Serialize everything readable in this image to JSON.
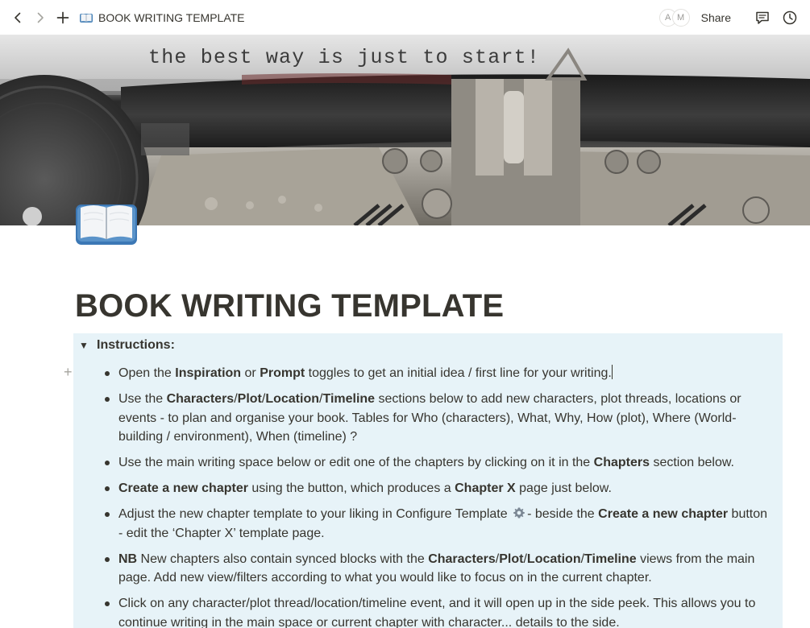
{
  "topbar": {
    "breadcrumb_title": "BOOK WRITING TEMPLATE",
    "avatars": [
      "A",
      "M"
    ],
    "share_label": "Share"
  },
  "icons": {
    "back": "chevron-left-icon",
    "forward": "chevron-right-icon",
    "new_page": "plus-icon",
    "page": "open-book-icon",
    "comments": "comment-icon",
    "history": "clock-icon",
    "settings": "gear-icon"
  },
  "cover": {
    "typed_text": "the best way is just to start!"
  },
  "page": {
    "title": "BOOK WRITING TEMPLATE"
  },
  "callout": {
    "background": "#e7f3f8",
    "toggle_label": "Instructions:",
    "toggle_arrow": "▼",
    "items": [
      {
        "p1": "Open the ",
        "b1": "Inspiration",
        "p2": " or ",
        "b2": "Prompt",
        "p3": " toggles to get an initial idea / first line for your writing."
      },
      {
        "p1": "Use the ",
        "b1": "Characters",
        "s1": "/",
        "b2": "Plot",
        "s2": "/",
        "b3": "Location",
        "s3": "/",
        "b4": "Timeline",
        "p2": " sections below to add new characters, plot threads, locations or events - to plan and organise your book. Tables for Who (characters), What, Why, How (plot), Where (World-building / environment), When (timeline) ?"
      },
      {
        "p1": "Use the main writing space below or edit one of the chapters by clicking on it in the ",
        "b1": "Chapters",
        "p2": " section below."
      },
      {
        "b1": "Create a new chapter",
        "p1": " using the button, which produces a ",
        "b2": "Chapter X",
        "p2": " page just below."
      },
      {
        "p1": "Adjust the new chapter template to your liking in Configure Template ",
        "p2": "- beside the ",
        "b1": "Create a new chapter",
        "p3": " button - edit the ‘Chapter X’ template page."
      },
      {
        "b1": "NB",
        "p1": " New chapters also contain synced blocks with the ",
        "b2": "Characters",
        "s1": "/",
        "b3": "Plot",
        "s2": "/",
        "b4": "Location",
        "s3": "/",
        "b5": "Timeline",
        "p2": " views from the main page. Add new view/filters according to what you would like to focus on in the current chapter."
      },
      {
        "p1": "Click on any character/plot thread/location/timeline event, and it will open up in the side peek. This allows you to continue writing in the main space or current chapter with character... details to the side."
      }
    ]
  }
}
